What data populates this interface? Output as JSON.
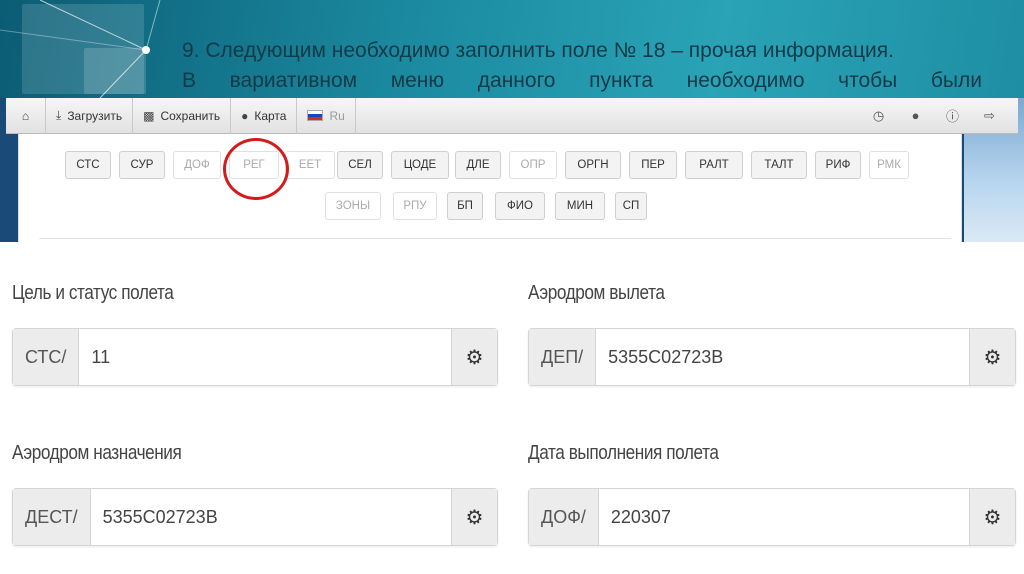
{
  "slide": {
    "line1": "9. Следующим необходимо заполнить поле № 18 – прочая информация.",
    "line2": "В вариативном меню данного пункта необходимо чтобы были"
  },
  "toolbar": {
    "home_icon": "home-icon",
    "upload_label": "Загрузить",
    "save_label": "Сохранить",
    "map_label": "Карта",
    "lang_label": "Ru",
    "right_icons": [
      "clock-icon",
      "user-icon",
      "info-icon",
      "logout-icon"
    ]
  },
  "field_buttons": {
    "row1": [
      {
        "label": "СТС",
        "filled": true
      },
      {
        "label": "СУР",
        "filled": true
      },
      {
        "label": "ДОФ",
        "filled": false
      },
      {
        "label": "РЕГ",
        "filled": false
      },
      {
        "label": "ЕЕТ",
        "filled": false
      },
      {
        "label": "СЕЛ",
        "filled": true
      },
      {
        "label": "ЦОДЕ",
        "filled": true
      },
      {
        "label": "ДЛЕ",
        "filled": true
      },
      {
        "label": "ОПР",
        "filled": false
      },
      {
        "label": "ОРГН",
        "filled": true
      },
      {
        "label": "ПЕР",
        "filled": true
      },
      {
        "label": "РАЛТ",
        "filled": true
      },
      {
        "label": "ТАЛТ",
        "filled": true
      },
      {
        "label": "РИФ",
        "filled": true
      },
      {
        "label": "РМК",
        "filled": false
      }
    ],
    "row2": [
      {
        "label": "ЗОНЫ",
        "filled": false
      },
      {
        "label": "РПУ",
        "filled": false
      },
      {
        "label": "БП",
        "filled": true
      },
      {
        "label": "ФИО",
        "filled": true
      },
      {
        "label": "МИН",
        "filled": true
      },
      {
        "label": "СП",
        "filled": true
      }
    ]
  },
  "form": {
    "purpose": {
      "label": "Цель и статус полета",
      "prefix": "СТС/",
      "value": "11"
    },
    "departure": {
      "label": "Аэродром вылета",
      "prefix": "ДЕП/",
      "value": "5355С02723В"
    },
    "destination": {
      "label": "Аэродром назначения",
      "prefix": "ДЕСТ/",
      "value": "5355С02723В"
    },
    "date": {
      "label": "Дата выполнения полета",
      "prefix": "ДОФ/",
      "value": "220307"
    },
    "settings_icon": "gear-icon"
  },
  "colors": {
    "header_teal": "#1b8aa0",
    "highlight_circle": "#d41a1a",
    "app_background": "#1a4a78"
  }
}
